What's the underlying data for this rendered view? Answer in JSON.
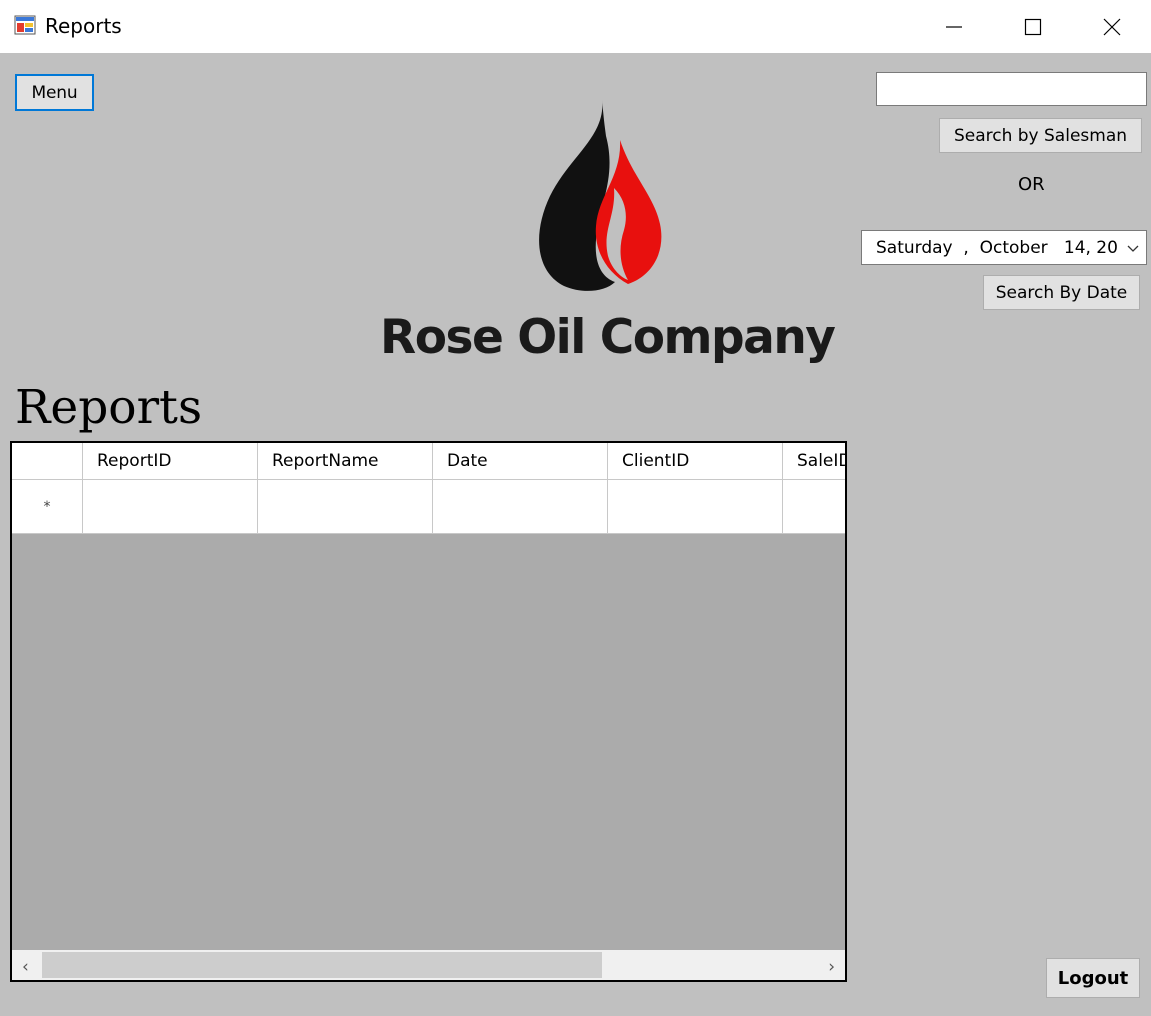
{
  "window": {
    "title": "Reports"
  },
  "toolbar": {
    "menu_label": "Menu",
    "logout_label": "Logout"
  },
  "search": {
    "salesman_value": "",
    "salesman_button": "Search by Salesman",
    "or_label": "OR",
    "date_value": "Saturday  ,  October   14, 20",
    "date_button": "Search By Date"
  },
  "brand": {
    "company_name": "Rose Oil Company",
    "colors": {
      "flame_dark": "#111111",
      "flame_red": "#e8100e"
    }
  },
  "page": {
    "heading": "Reports"
  },
  "grid": {
    "columns": [
      "ReportID",
      "ReportName",
      "Date",
      "ClientID",
      "SaleID"
    ],
    "new_row_marker": "*"
  },
  "colors": {
    "background": "#c0c0c0",
    "grid_empty": "#ababab",
    "focus_border": "#0078d7"
  }
}
